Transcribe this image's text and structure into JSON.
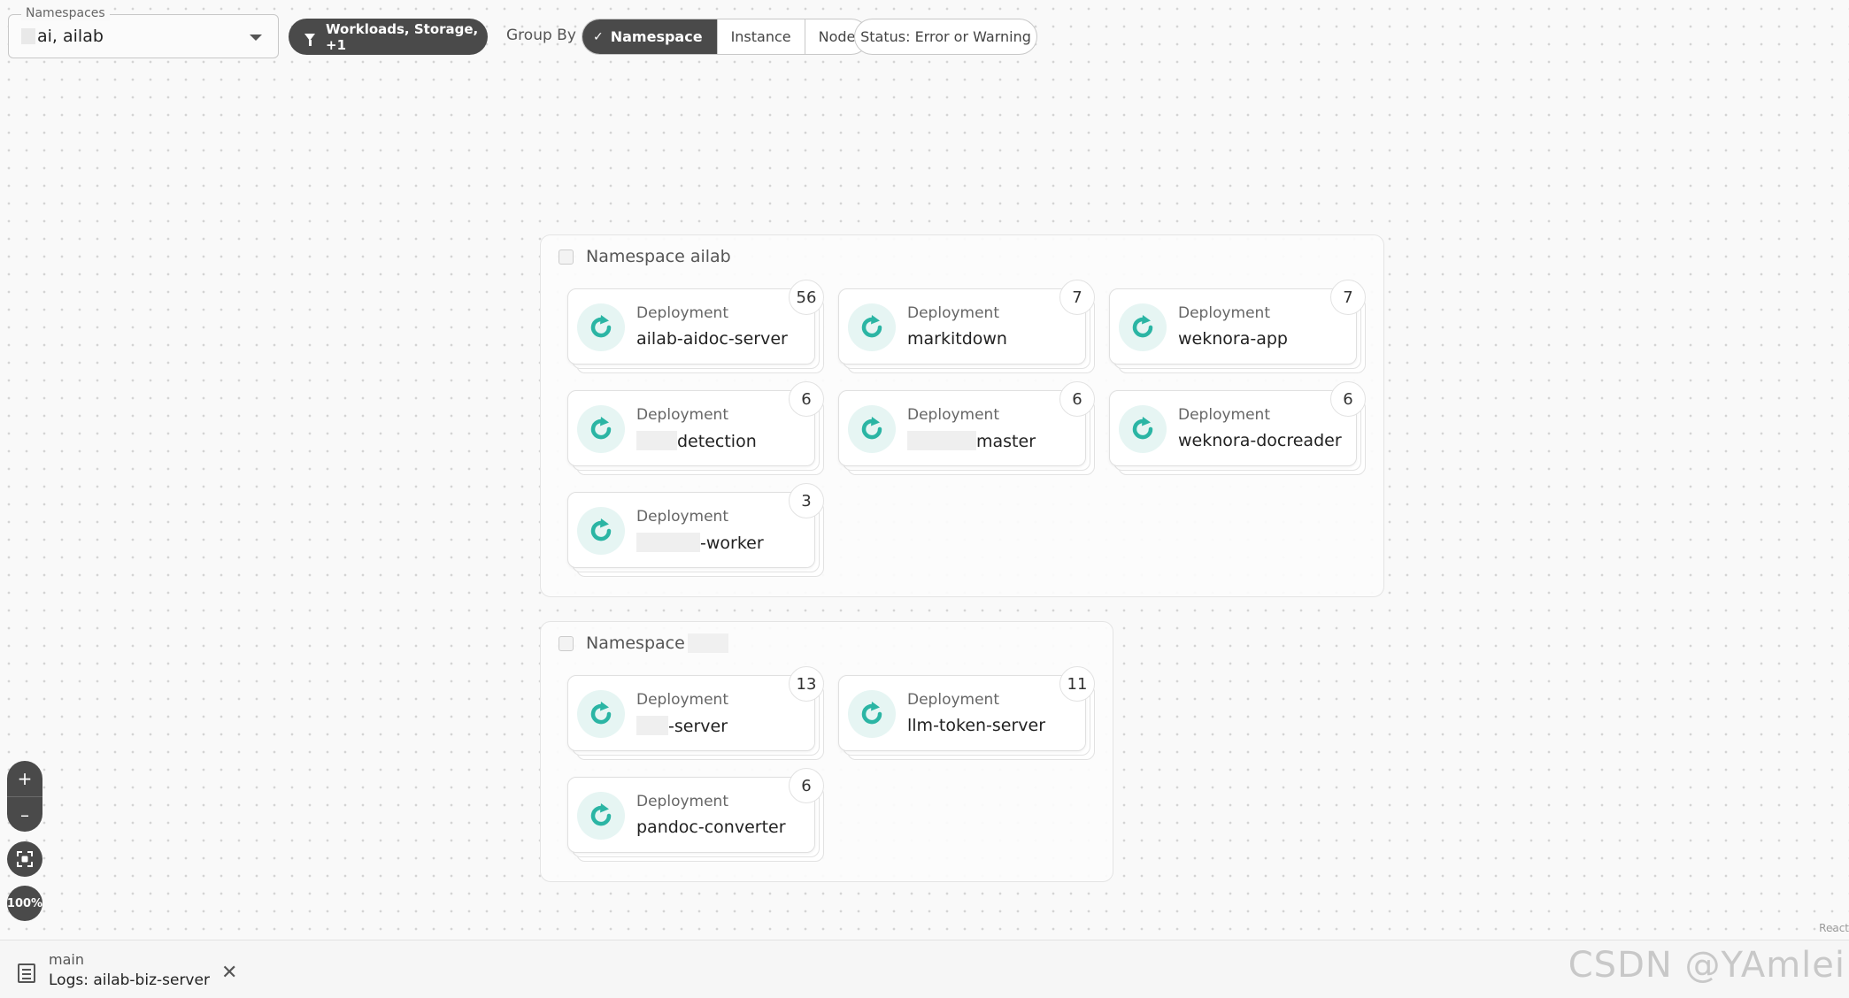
{
  "toolbar": {
    "namespaces_label": "Namespaces",
    "namespaces_value": "ai, ailab",
    "filter_label": "Workloads, Storage, +1",
    "group_by_label": "Group By",
    "group_by_options": [
      "Namespace",
      "Instance",
      "Node"
    ],
    "group_by_selected": "Namespace",
    "status_filter_label": "Status: Error or Warning"
  },
  "groups": [
    {
      "title": "Namespace ailab",
      "deployments": [
        {
          "kind": "Deployment",
          "name": "ailab-aidoc-server",
          "count": "56"
        },
        {
          "kind": "Deployment",
          "name": "markitdown",
          "count": "7"
        },
        {
          "kind": "Deployment",
          "name": "weknora-app",
          "count": "7"
        },
        {
          "kind": "Deployment",
          "name": "detection",
          "count": "6"
        },
        {
          "kind": "Deployment",
          "name": "master",
          "count": "6"
        },
        {
          "kind": "Deployment",
          "name": "weknora-docreader",
          "count": "6"
        },
        {
          "kind": "Deployment",
          "name": "-worker",
          "count": "3"
        }
      ]
    },
    {
      "title": "Namespace",
      "deployments": [
        {
          "kind": "Deployment",
          "name": "-server",
          "count": "13"
        },
        {
          "kind": "Deployment",
          "name": "llm-token-server",
          "count": "11"
        },
        {
          "kind": "Deployment",
          "name": "pandoc-converter",
          "count": "6"
        }
      ]
    }
  ],
  "zoom": {
    "zoom_in": "+",
    "zoom_out": "–",
    "level": "100%"
  },
  "attribution": "React",
  "bottom_bar": {
    "branch": "main",
    "title": "Logs: ailab-biz-server",
    "close": "✕"
  },
  "watermark": "CSDN @YAmlei",
  "colors": {
    "accent_teal": "#2bb5a4",
    "dark_button": "#4a4a4a"
  }
}
